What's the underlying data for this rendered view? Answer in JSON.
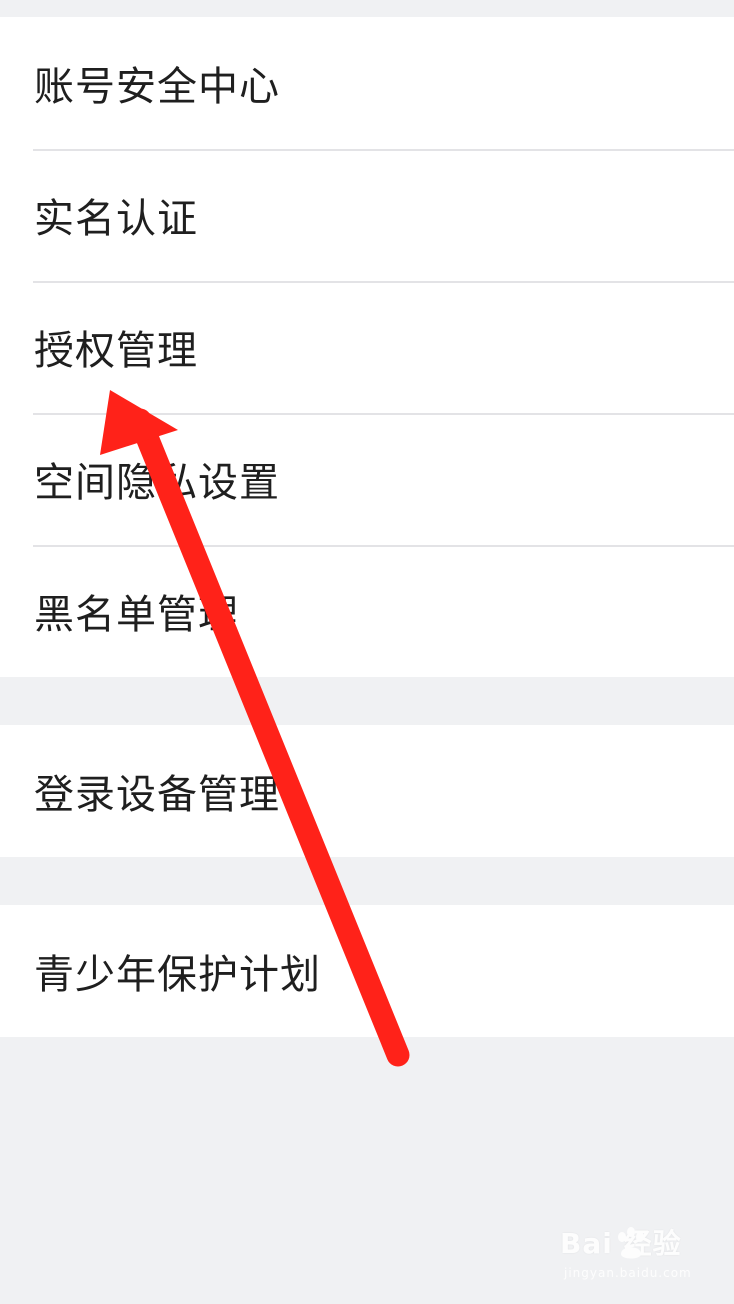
{
  "groups": [
    {
      "items": [
        {
          "label": "账号安全中心"
        },
        {
          "label": "实名认证"
        },
        {
          "label": "授权管理"
        },
        {
          "label": "空间隐私设置"
        },
        {
          "label": "黑名单管理"
        }
      ]
    },
    {
      "items": [
        {
          "label": "登录设备管理"
        }
      ]
    },
    {
      "items": [
        {
          "label": "青少年保护计划"
        }
      ]
    }
  ],
  "annotation": {
    "arrow_color": "#ff2219",
    "icon": "arrow-annotation"
  },
  "watermark": {
    "brand": "Bai  经验",
    "sub": "jingyan.baidu.com",
    "icon": "paw-icon"
  },
  "colors": {
    "background": "#f0f1f3",
    "row_background": "#ffffff",
    "separator": "#e3e3e6",
    "text": "#1f1f1f"
  }
}
